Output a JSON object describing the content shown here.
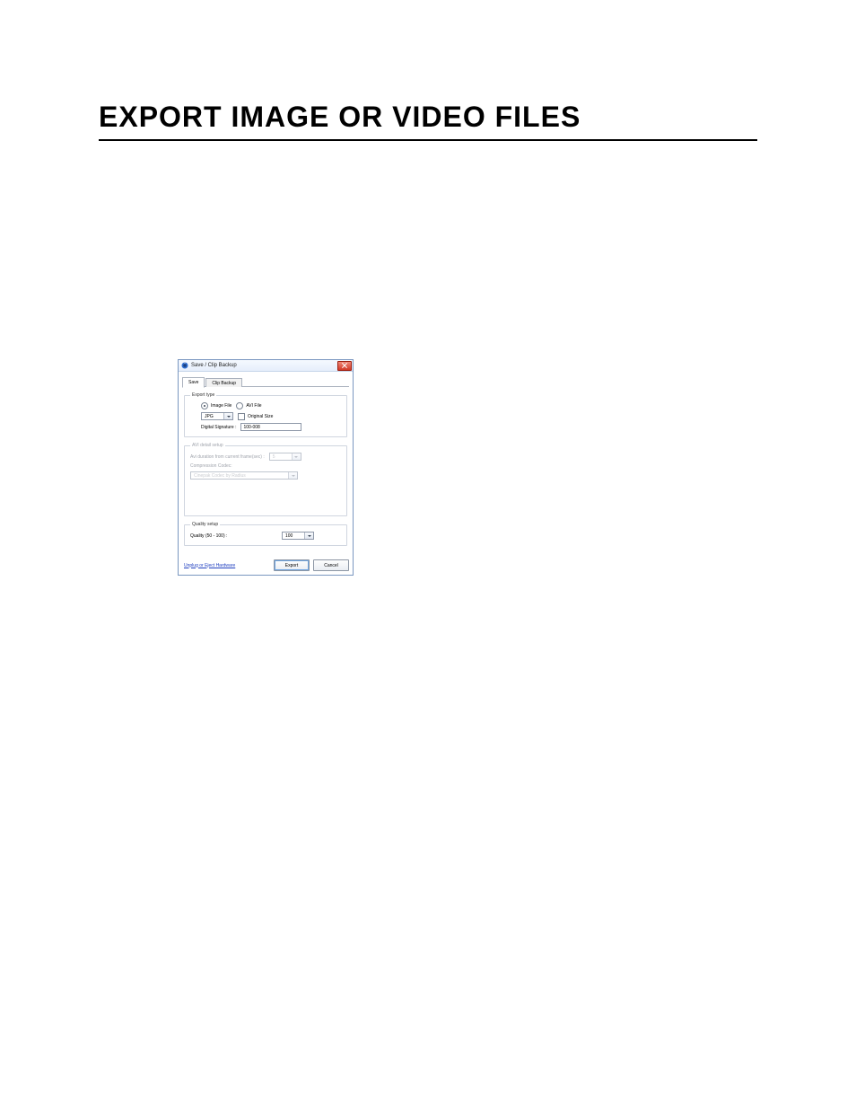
{
  "page": {
    "title": "EXPORT IMAGE OR VIDEO FILES"
  },
  "dialog": {
    "title": "Save / Clip Backup",
    "tabs": {
      "save": "Save",
      "clip_backup": "Clip Backup"
    },
    "export_type": {
      "legend": "Export type",
      "image_file": "Image File",
      "avi_file": "AVI File",
      "format_select": "JPG",
      "original_size": "Original Size",
      "digital_signature_label": "Digital Signature :",
      "digital_signature_value": "100-008"
    },
    "avi_setup": {
      "legend": "AVI detail setup",
      "duration_label": "Avi duration from current frame(sec) :",
      "duration_value": "5",
      "codec_label": "Compression Codec:",
      "codec_value": "Cinepak Codec by Radius"
    },
    "quality": {
      "legend": "Quality setup",
      "label": "Quality (50 - 100) :",
      "value": "100"
    },
    "footer": {
      "link": "Unplug or Eject Hardware",
      "export_btn": "Export",
      "cancel_btn": "Cancel"
    }
  }
}
